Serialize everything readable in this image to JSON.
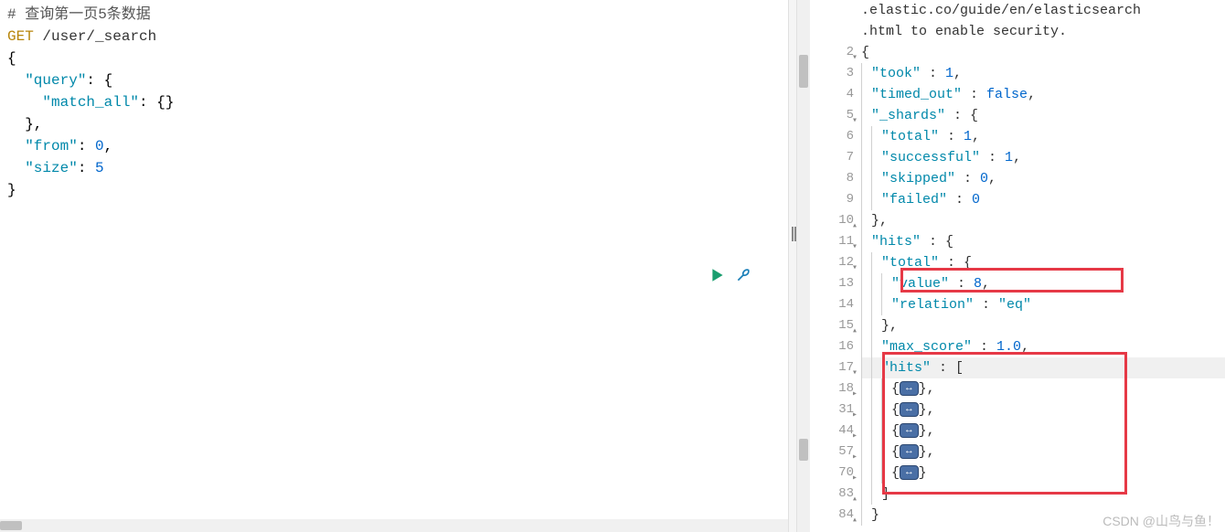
{
  "left": {
    "comment": "# 查询第一页5条数据",
    "method": "GET",
    "url": "/user/_search",
    "body_lines": [
      "{",
      "  \"query\": {",
      "    \"match_all\": {}",
      "  },",
      "  \"from\": 0,",
      "  \"size\": 5",
      "}"
    ]
  },
  "right": {
    "info1": ".elastic.co/guide/en/elasticsearch",
    "info2": ".html to enable security.",
    "lines": [
      {
        "num": "2",
        "fold": "▾",
        "content": [
          {
            "t": "brace",
            "v": "{"
          }
        ]
      },
      {
        "num": "3",
        "fold": "",
        "content": [
          {
            "t": "ind",
            "v": 1
          },
          {
            "t": "key",
            "v": "\"took\""
          },
          {
            "t": "txt",
            "v": " : "
          },
          {
            "t": "num",
            "v": "1"
          },
          {
            "t": "txt",
            "v": ","
          }
        ]
      },
      {
        "num": "4",
        "fold": "",
        "content": [
          {
            "t": "ind",
            "v": 1
          },
          {
            "t": "key",
            "v": "\"timed_out\""
          },
          {
            "t": "txt",
            "v": " : "
          },
          {
            "t": "bool",
            "v": "false"
          },
          {
            "t": "txt",
            "v": ","
          }
        ]
      },
      {
        "num": "5",
        "fold": "▾",
        "content": [
          {
            "t": "ind",
            "v": 1
          },
          {
            "t": "key",
            "v": "\"_shards\""
          },
          {
            "t": "txt",
            "v": " : {"
          }
        ]
      },
      {
        "num": "6",
        "fold": "",
        "content": [
          {
            "t": "ind",
            "v": 2
          },
          {
            "t": "key",
            "v": "\"total\""
          },
          {
            "t": "txt",
            "v": " : "
          },
          {
            "t": "num",
            "v": "1"
          },
          {
            "t": "txt",
            "v": ","
          }
        ]
      },
      {
        "num": "7",
        "fold": "",
        "content": [
          {
            "t": "ind",
            "v": 2
          },
          {
            "t": "key",
            "v": "\"successful\""
          },
          {
            "t": "txt",
            "v": " : "
          },
          {
            "t": "num",
            "v": "1"
          },
          {
            "t": "txt",
            "v": ","
          }
        ]
      },
      {
        "num": "8",
        "fold": "",
        "content": [
          {
            "t": "ind",
            "v": 2
          },
          {
            "t": "key",
            "v": "\"skipped\""
          },
          {
            "t": "txt",
            "v": " : "
          },
          {
            "t": "num",
            "v": "0"
          },
          {
            "t": "txt",
            "v": ","
          }
        ]
      },
      {
        "num": "9",
        "fold": "",
        "content": [
          {
            "t": "ind",
            "v": 2
          },
          {
            "t": "key",
            "v": "\"failed\""
          },
          {
            "t": "txt",
            "v": " : "
          },
          {
            "t": "num",
            "v": "0"
          }
        ]
      },
      {
        "num": "10",
        "fold": "▴",
        "content": [
          {
            "t": "ind",
            "v": 1
          },
          {
            "t": "txt",
            "v": "},"
          }
        ]
      },
      {
        "num": "11",
        "fold": "▾",
        "content": [
          {
            "t": "ind",
            "v": 1
          },
          {
            "t": "key",
            "v": "\"hits\""
          },
          {
            "t": "txt",
            "v": " : {"
          }
        ]
      },
      {
        "num": "12",
        "fold": "▾",
        "content": [
          {
            "t": "ind",
            "v": 2
          },
          {
            "t": "key",
            "v": "\"total\""
          },
          {
            "t": "txt",
            "v": " : {"
          }
        ]
      },
      {
        "num": "13",
        "fold": "",
        "content": [
          {
            "t": "ind",
            "v": 3
          },
          {
            "t": "key",
            "v": "\"value\""
          },
          {
            "t": "txt",
            "v": " : "
          },
          {
            "t": "num",
            "v": "8"
          },
          {
            "t": "txt",
            "v": ","
          }
        ]
      },
      {
        "num": "14",
        "fold": "",
        "content": [
          {
            "t": "ind",
            "v": 3
          },
          {
            "t": "key",
            "v": "\"relation\""
          },
          {
            "t": "txt",
            "v": " : "
          },
          {
            "t": "str",
            "v": "\"eq\""
          }
        ]
      },
      {
        "num": "15",
        "fold": "▴",
        "content": [
          {
            "t": "ind",
            "v": 2
          },
          {
            "t": "txt",
            "v": "},"
          }
        ]
      },
      {
        "num": "16",
        "fold": "",
        "content": [
          {
            "t": "ind",
            "v": 2
          },
          {
            "t": "key",
            "v": "\"max_score\""
          },
          {
            "t": "txt",
            "v": " : "
          },
          {
            "t": "num",
            "v": "1.0"
          },
          {
            "t": "txt",
            "v": ","
          }
        ]
      },
      {
        "num": "17",
        "fold": "▾",
        "highlight": true,
        "content": [
          {
            "t": "ind",
            "v": 2
          },
          {
            "t": "key",
            "v": "\"hits\""
          },
          {
            "t": "txt",
            "v": " : ["
          }
        ]
      },
      {
        "num": "18",
        "fold": "▸",
        "content": [
          {
            "t": "ind",
            "v": 3
          },
          {
            "t": "txt",
            "v": "{"
          },
          {
            "t": "badge",
            "v": "↔"
          },
          {
            "t": "txt",
            "v": "},"
          }
        ]
      },
      {
        "num": "31",
        "fold": "▸",
        "content": [
          {
            "t": "ind",
            "v": 3
          },
          {
            "t": "txt",
            "v": "{"
          },
          {
            "t": "badge",
            "v": "↔"
          },
          {
            "t": "txt",
            "v": "},"
          }
        ]
      },
      {
        "num": "44",
        "fold": "▸",
        "content": [
          {
            "t": "ind",
            "v": 3
          },
          {
            "t": "txt",
            "v": "{"
          },
          {
            "t": "badge",
            "v": "↔"
          },
          {
            "t": "txt",
            "v": "},"
          }
        ]
      },
      {
        "num": "57",
        "fold": "▸",
        "content": [
          {
            "t": "ind",
            "v": 3
          },
          {
            "t": "txt",
            "v": "{"
          },
          {
            "t": "badge",
            "v": "↔"
          },
          {
            "t": "txt",
            "v": "},"
          }
        ]
      },
      {
        "num": "70",
        "fold": "▸",
        "content": [
          {
            "t": "ind",
            "v": 3
          },
          {
            "t": "txt",
            "v": "{"
          },
          {
            "t": "badge",
            "v": "↔"
          },
          {
            "t": "txt",
            "v": "}"
          }
        ]
      },
      {
        "num": "83",
        "fold": "▴",
        "content": [
          {
            "t": "ind",
            "v": 2
          },
          {
            "t": "txt",
            "v": "]"
          }
        ]
      },
      {
        "num": "84",
        "fold": "▴",
        "content": [
          {
            "t": "ind",
            "v": 1
          },
          {
            "t": "txt",
            "v": "}"
          }
        ]
      }
    ]
  },
  "attrib": "CSDN @山鸟与鱼！"
}
